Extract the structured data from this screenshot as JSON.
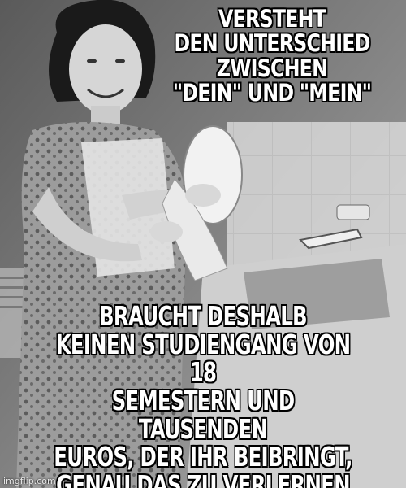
{
  "meme": {
    "top_text": "VERSTEHT\nDEN UNTERSCHIED\nZWISCHEN\n\"DEIN\" UND \"MEIN\"",
    "bottom_text": "BRAUCHT DESHALB\nKEINEN STUDIENGANG VON 18\nSEMESTERN UND TAUSENDEN\nEUROS, DER IHR BEIBRINGT,\nGENAU DAS ZU VERLERNEN",
    "watermark": "imgflip.com"
  },
  "colors": {
    "background": "#6f6f6f",
    "caption_fill": "#ffffff",
    "caption_outline": "#000000"
  }
}
